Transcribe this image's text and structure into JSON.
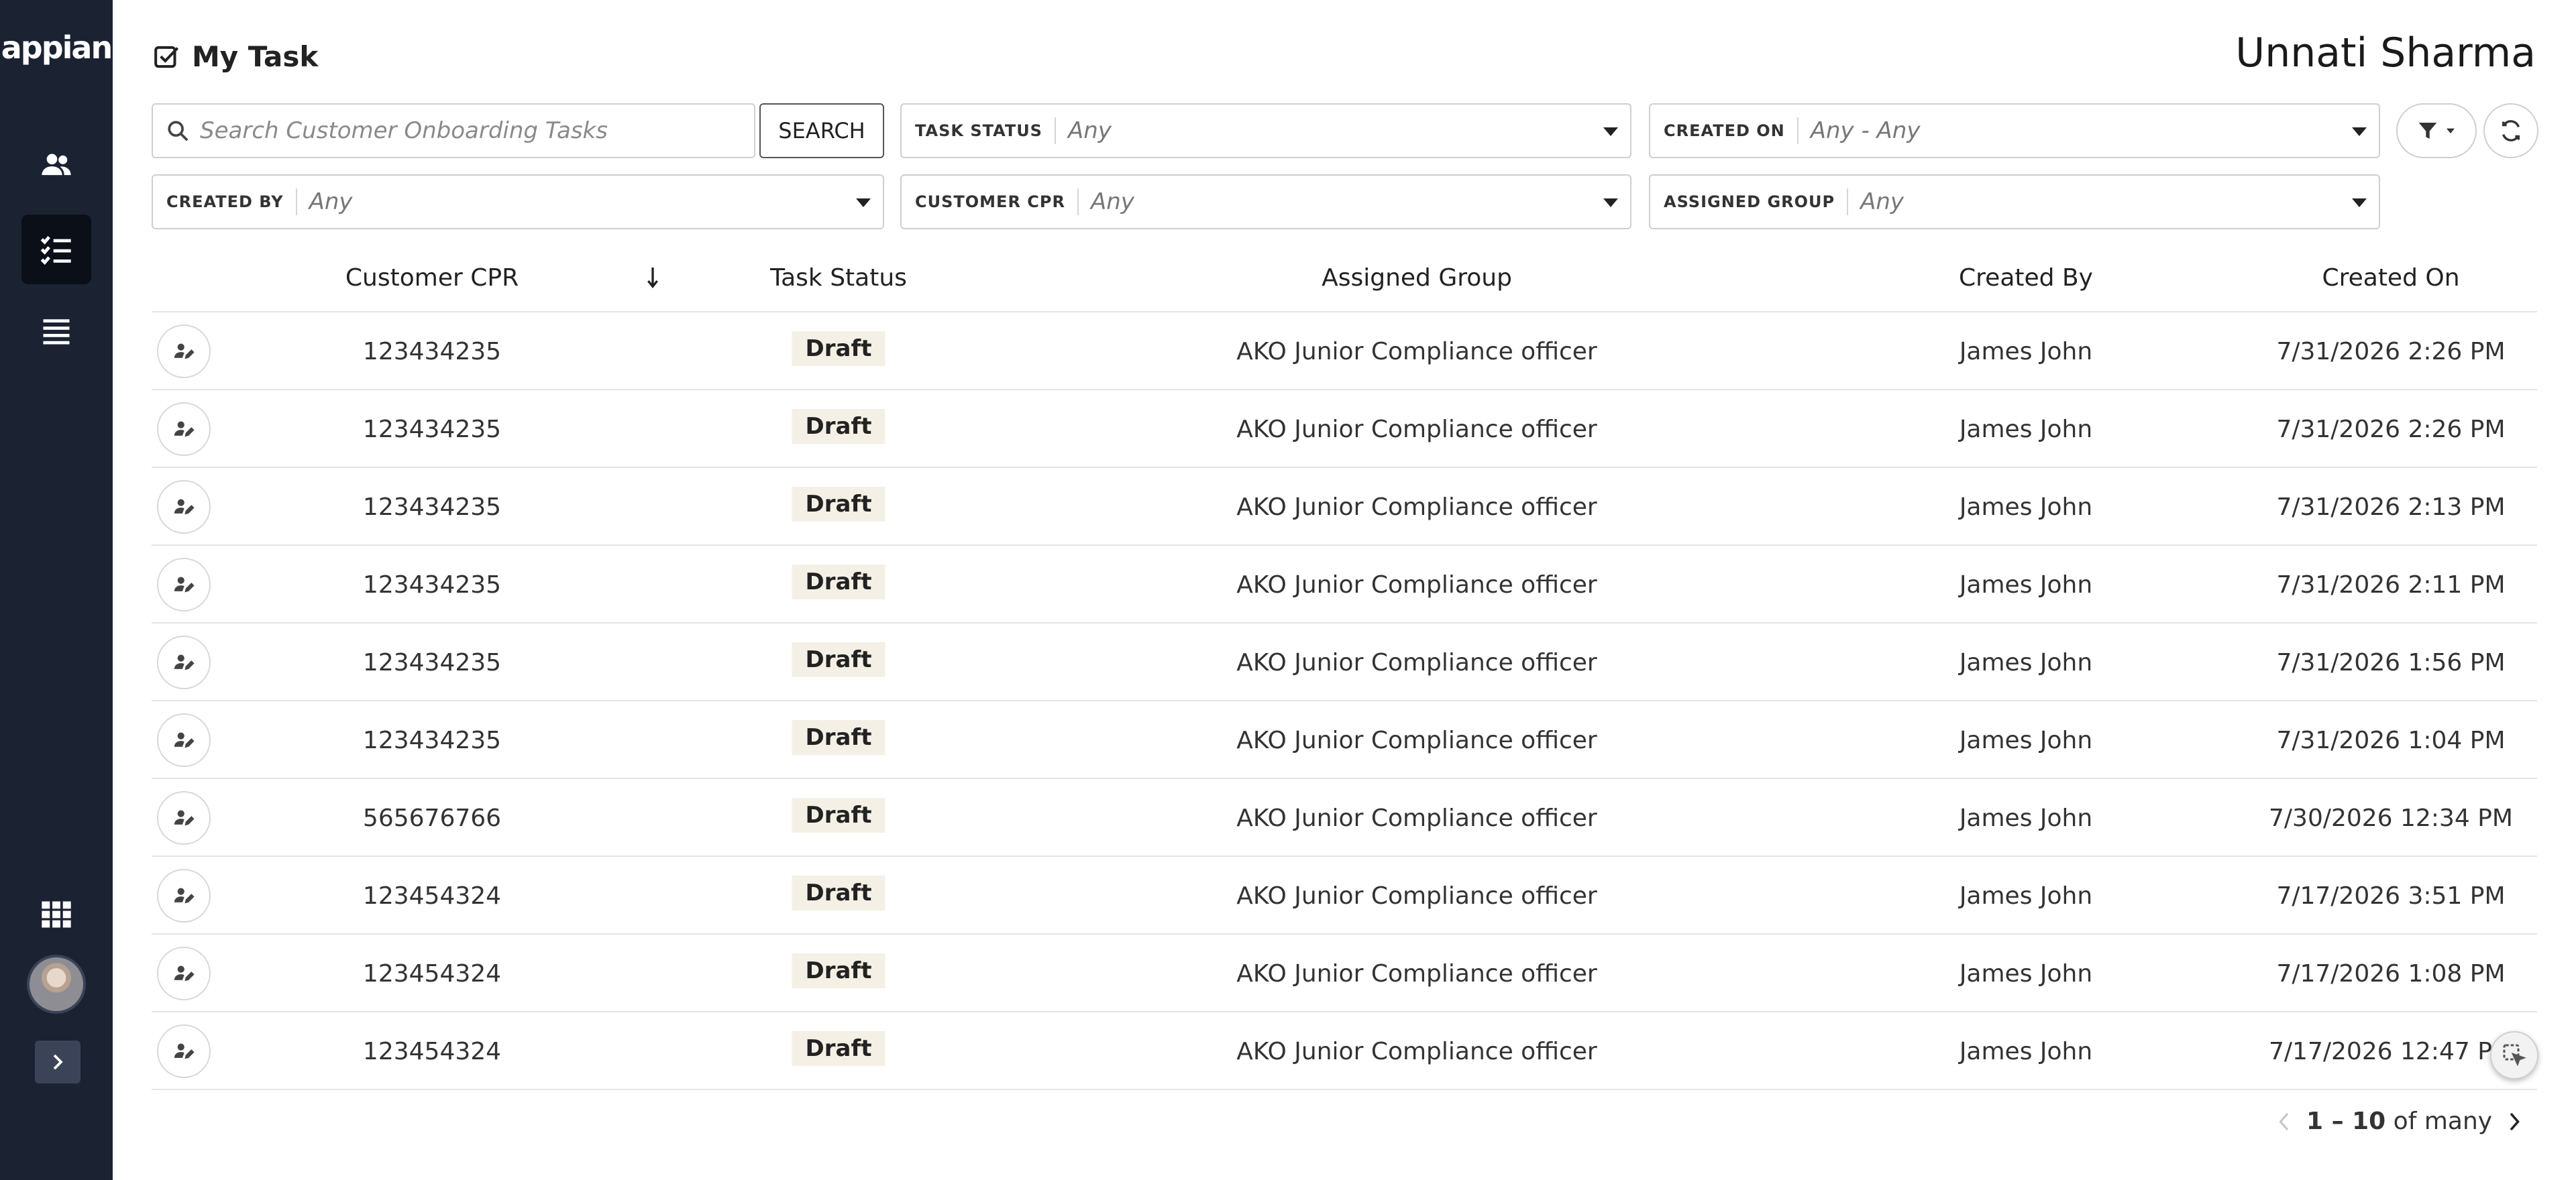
{
  "app": {
    "logo": "appian"
  },
  "header": {
    "title": "My Task",
    "user_name": "Unnati Sharma"
  },
  "search": {
    "placeholder": "Search Customer Onboarding Tasks",
    "button_label": "SEARCH"
  },
  "filters": {
    "task_status": {
      "label": "TASK STATUS",
      "value": "Any"
    },
    "created_on": {
      "label": "CREATED ON",
      "value": "Any - Any"
    },
    "created_by": {
      "label": "CREATED BY",
      "value": "Any"
    },
    "customer_cpr": {
      "label": "CUSTOMER CPR",
      "value": "Any"
    },
    "assigned_group": {
      "label": "ASSIGNED GROUP",
      "value": "Any"
    }
  },
  "table": {
    "columns": [
      "Customer CPR",
      "Task Status",
      "Assigned Group",
      "Created By",
      "Created On"
    ],
    "rows": [
      {
        "cpr": "123434235",
        "status": "Draft",
        "group": "AKO Junior Compliance officer",
        "created_by": "James John",
        "created_on": "7/31/2026 2:26 PM"
      },
      {
        "cpr": "123434235",
        "status": "Draft",
        "group": "AKO Junior Compliance officer",
        "created_by": "James John",
        "created_on": "7/31/2026 2:26 PM"
      },
      {
        "cpr": "123434235",
        "status": "Draft",
        "group": "AKO Junior Compliance officer",
        "created_by": "James John",
        "created_on": "7/31/2026 2:13 PM"
      },
      {
        "cpr": "123434235",
        "status": "Draft",
        "group": "AKO Junior Compliance officer",
        "created_by": "James John",
        "created_on": "7/31/2026 2:11 PM"
      },
      {
        "cpr": "123434235",
        "status": "Draft",
        "group": "AKO Junior Compliance officer",
        "created_by": "James John",
        "created_on": "7/31/2026 1:56 PM"
      },
      {
        "cpr": "123434235",
        "status": "Draft",
        "group": "AKO Junior Compliance officer",
        "created_by": "James John",
        "created_on": "7/31/2026 1:04 PM"
      },
      {
        "cpr": "565676766",
        "status": "Draft",
        "group": "AKO Junior Compliance officer",
        "created_by": "James John",
        "created_on": "7/30/2026 12:34 PM"
      },
      {
        "cpr": "123454324",
        "status": "Draft",
        "group": "AKO Junior Compliance officer",
        "created_by": "James John",
        "created_on": "7/17/2026 3:51 PM"
      },
      {
        "cpr": "123454324",
        "status": "Draft",
        "group": "AKO Junior Compliance officer",
        "created_by": "James John",
        "created_on": "7/17/2026 1:08 PM"
      },
      {
        "cpr": "123454324",
        "status": "Draft",
        "group": "AKO Junior Compliance officer",
        "created_by": "James John",
        "created_on": "7/17/2026 12:47 PM"
      }
    ]
  },
  "pagination": {
    "range": "1 – 10",
    "suffix": "of many"
  },
  "icons": {
    "sidebar": [
      "users-icon",
      "task-list-icon",
      "records-list-icon",
      "apps-grid-icon",
      "chevron-right-icon"
    ],
    "row_action": "assign-user-icon",
    "title": "checkbox-icon"
  },
  "colors": {
    "sidebar_bg": "#1b2333",
    "badge_bg": "#f4f0e6"
  }
}
